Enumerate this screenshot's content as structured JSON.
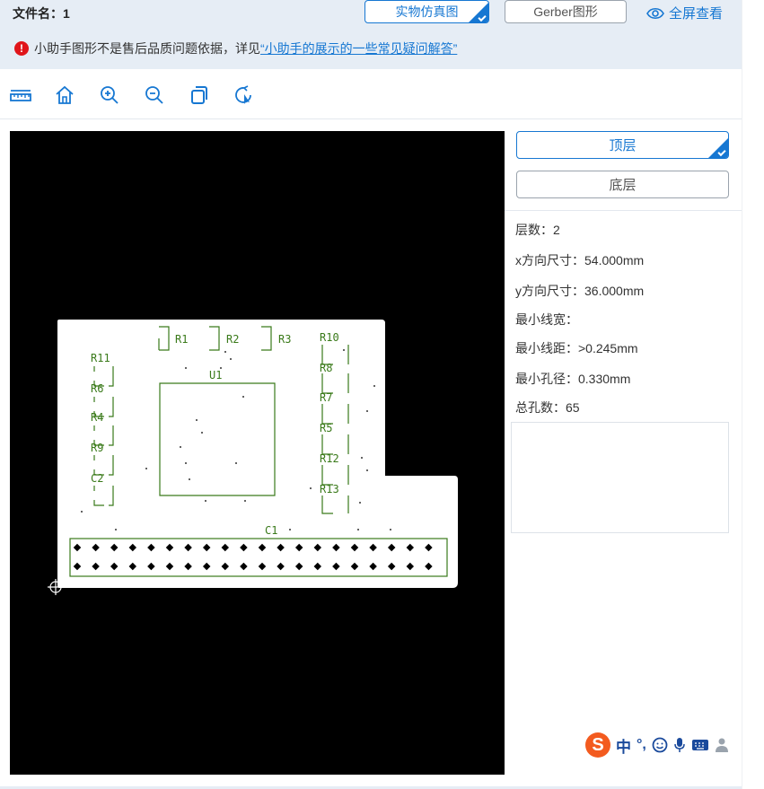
{
  "header": {
    "filename_label": "文件名：1",
    "tab_real_sim": "实物仿真图",
    "tab_gerber": "Gerber图形",
    "fullscreen_label": "全屏查看"
  },
  "notice": {
    "text": "小助手图形不是售后品质问题依据，详见",
    "link": "“小助手的展示的一些常见疑问解答”"
  },
  "toolbar": {
    "tools": [
      "ruler-icon",
      "home-icon",
      "zoom-in-icon",
      "zoom-out-icon",
      "copy-icon",
      "rotate-icon"
    ]
  },
  "layers": {
    "top_label": "顶层",
    "bottom_label": "底层",
    "selected": "顶层"
  },
  "board_info": {
    "layers": "层数：2",
    "x_size_label": "x方向尺寸：",
    "x_size_value": "54.000mm",
    "y_size_label": "y方向尺寸：",
    "y_size_value": "36.000mm",
    "min_width_label": "最小线宽：",
    "min_space_label": "最小线距：",
    "min_space_value": ">0.245mm",
    "min_hole_label": "最小孔径：",
    "min_hole_value": "0.330mm",
    "holes": "总孔数：65"
  },
  "pcb_labels": {
    "r1": "R1",
    "r2": "R2",
    "r3": "R3",
    "r10": "R10",
    "r11": "R11",
    "r8": "R8",
    "u1": "U1",
    "r6": "R6",
    "r7": "R7",
    "r4": "R4",
    "r5": "R5",
    "r9": "R9",
    "r12": "R12",
    "c2": "C2",
    "r13": "R13",
    "c1": "C1"
  },
  "ime": {
    "lang": "中",
    "punct": "°,"
  },
  "colors": {
    "accent": "#1677d2",
    "silkscreen": "#3a7a1a",
    "board": "#ffffff",
    "background": "#000000"
  }
}
